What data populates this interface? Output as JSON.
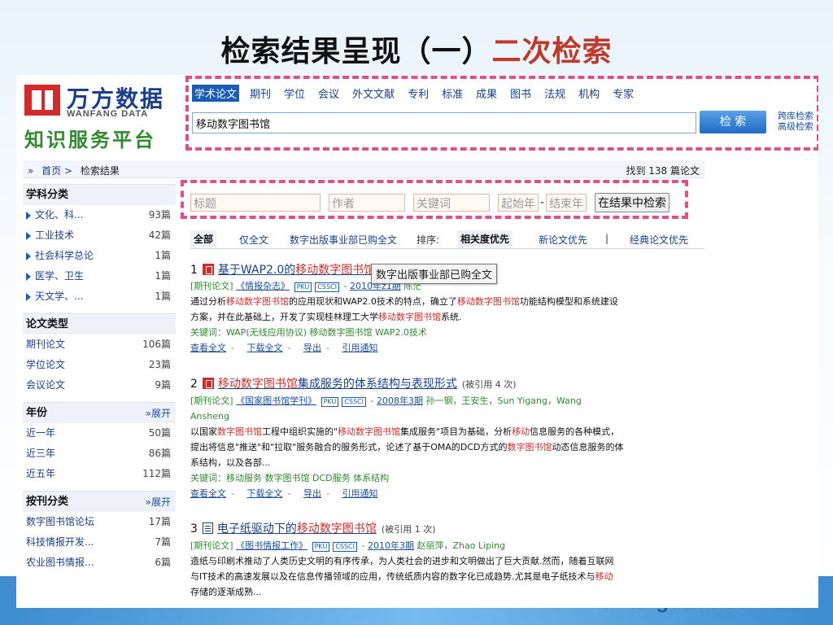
{
  "slide": {
    "title_main": "检索结果呈现（一）",
    "title_highlight": "二次检索",
    "footer": "www.wanfangdata.com.cn"
  },
  "logo": {
    "cn": "万方数据",
    "en": "WANFANG DATA",
    "sub": "知识服务平台"
  },
  "search": {
    "tabs": [
      "学术论文",
      "期刊",
      "学位",
      "会议",
      "外文文献",
      "专利",
      "标准",
      "成果",
      "图书",
      "法规",
      "机构",
      "专家"
    ],
    "query": "移动数字图书馆",
    "button": "检 索",
    "cross_search": "跨库检索",
    "advanced_search": "高级检索"
  },
  "breadcrumb": {
    "arrow": "»",
    "home": "首页 >",
    "current": "检索结果",
    "found": "找到 138 篇论文"
  },
  "secondary": {
    "placeholders": [
      "标题",
      "作者",
      "关键词",
      "起始年",
      "结束年"
    ],
    "dash": "-",
    "button": "在结果中检索"
  },
  "filter": {
    "all": "全部",
    "full_text": "仅全文",
    "purchased": "数字出版事业部已购全文",
    "sort_label": "排序:",
    "relevance": "相关度优先",
    "newest": "新论文优先",
    "sep": "|",
    "classic": "经典论文优先"
  },
  "sidebar": {
    "subject": {
      "title": "学科分类",
      "items": [
        {
          "label": "文化、科...",
          "count": "93篇"
        },
        {
          "label": "工业技术",
          "count": "42篇"
        },
        {
          "label": "社会科学总论",
          "count": "1篇"
        },
        {
          "label": "医学、卫生",
          "count": "1篇"
        },
        {
          "label": "天文学、...",
          "count": "1篇"
        }
      ]
    },
    "doctype": {
      "title": "论文类型",
      "items": [
        {
          "label": "期刊论文",
          "count": "106篇"
        },
        {
          "label": "学位论文",
          "count": "23篇"
        },
        {
          "label": "会议论文",
          "count": "9篇"
        }
      ]
    },
    "year": {
      "title": "年份",
      "expand": "展开",
      "items": [
        {
          "label": "近一年",
          "count": "50篇"
        },
        {
          "label": "近三年",
          "count": "86篇"
        },
        {
          "label": "近五年",
          "count": "112篇"
        }
      ]
    },
    "journal": {
      "title": "按刊分类",
      "expand": "展开",
      "items": [
        {
          "label": "数字图书馆论坛",
          "count": "17篇"
        },
        {
          "label": "科技情报开发...",
          "count": "7篇"
        },
        {
          "label": "农业图书情报...",
          "count": "6篇"
        }
      ]
    }
  },
  "tooltip": "数字出版事业部已购全文",
  "results": [
    {
      "num": "1",
      "title_a": "基于WAP2.0的",
      "title_red": "移动数字图书馆",
      "title_b": "",
      "cited": "",
      "type": "[期刊论文]",
      "journal": "《情报杂志》",
      "tag1": "PKU",
      "tag2": "CSSCI",
      "dash": "-",
      "issue": "2010年z1期",
      "authors": "陈茫",
      "abs1_a": "通过分析",
      "abs1_red": "移动数字图书馆",
      "abs1_b": "的应用现状和WAP2.0技术的特点，确立了",
      "abs1_red2": "移动数字图书馆",
      "abs1_c": "功能结构模型和系统建设",
      "abs2_a": "方案，并在此基础上，开发了实现桂林理工大学",
      "abs2_red": "移动数字图书馆",
      "abs2_b": "系统.",
      "keywords": "关键词：WAP(无线应用协议)    移动数字图书馆    WAP2.0技术",
      "actions": [
        "查看全文",
        "下载全文",
        "导出",
        "引用通知"
      ]
    },
    {
      "num": "2",
      "title_a": "",
      "title_red": "移动数字图书馆",
      "title_b": "集成服务的体系结构与表现形式",
      "cited": "(被引用 4 次)",
      "type": "[期刊论文]",
      "journal": "《国家图书馆学刊》",
      "tag1": "PKU",
      "tag2": "CSSCI",
      "dash": "-",
      "issue": "2008年3期",
      "authors": "孙一钢，王安生，Sun Yigang，Wang",
      "authors2": "Ansheng",
      "abs1_a": "以国家",
      "abs1_red": "数字图书馆",
      "abs1_b": "工程中组织实施的\"",
      "abs1_red2": "移动数字图书馆",
      "abs1_c": "集成服务\"项目为基础，分析",
      "abs1_red3": "移动",
      "abs1_d": "信息服务的各种模式，",
      "abs2_a": "提出将信息\"推送\"和\"拉取\"服务融合的服务形式，论述了基于OMA的DCD方式的",
      "abs2_red": "数字图书馆",
      "abs2_b": "动态信息服务的体",
      "abs3": "系结构，以及各部...",
      "keywords": "关键词：移动服务    数字图书馆    DCD服务    体系结构",
      "actions": [
        "查看全文",
        "下载全文",
        "导出",
        "引用通知"
      ]
    },
    {
      "num": "3",
      "title_a": "电子纸驱动下的",
      "title_red": "移动数字图书馆",
      "title_b": "",
      "cited": "(被引用 1 次)",
      "type": "[期刊论文]",
      "journal": "《图书情报工作》",
      "tag1": "PKU",
      "tag2": "CSSCI",
      "dash": "-",
      "issue": "2010年3期",
      "authors": "赵丽萍，Zhao Liping",
      "abs1_a": "造纸与印刷术推动了人类历史文明的有序传承，为人类社会的进步和文明做出了巨大贡献.然而，随着互联网",
      "abs2_a": "与IT技术的高速发展以及在信息传播领域的应用，传统纸质内容的数字化已成趋势.尤其是电子纸技术与",
      "abs2_red": "移动",
      "abs3": "存储的逐渐成熟..."
    }
  ]
}
